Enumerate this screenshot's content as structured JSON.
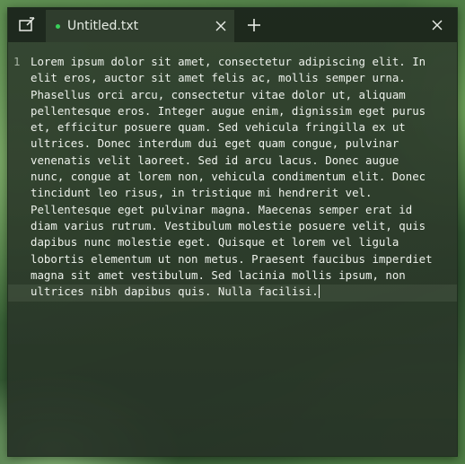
{
  "tab": {
    "title": "Untitled.txt",
    "modified_indicator_color": "#38d15a"
  },
  "icons": {
    "new_tab": "new-window-icon",
    "tab_close": "close-icon",
    "add_tab": "plus-icon",
    "window_close": "close-icon"
  },
  "editor": {
    "line_number": "1",
    "lines": [
      "Lorem ipsum dolor sit amet, consectetur adipiscing elit. In",
      "elit eros, auctor sit amet felis ac, mollis semper urna.",
      "Phasellus orci arcu, consectetur vitae dolor ut, aliquam",
      "pellentesque eros. Integer augue enim, dignissim eget purus",
      "et, efficitur posuere quam. Sed vehicula fringilla ex ut",
      "ultrices. Donec interdum dui eget quam congue, pulvinar",
      "venenatis velit laoreet. Sed id arcu lacus. Donec augue",
      "nunc, congue at lorem non, vehicula condimentum elit. Donec",
      "tincidunt leo risus, in tristique mi hendrerit vel.",
      "Pellentesque eget pulvinar magna. Maecenas semper erat id",
      "diam varius rutrum. Vestibulum molestie posuere velit, quis",
      "dapibus nunc molestie eget. Quisque et lorem vel ligula",
      "lobortis elementum ut non metus. Praesent faucibus imperdiet",
      "magna sit amet vestibulum. Sed lacinia mollis ipsum, non",
      "ultrices nibh dapibus quis. Nulla facilisi."
    ]
  }
}
